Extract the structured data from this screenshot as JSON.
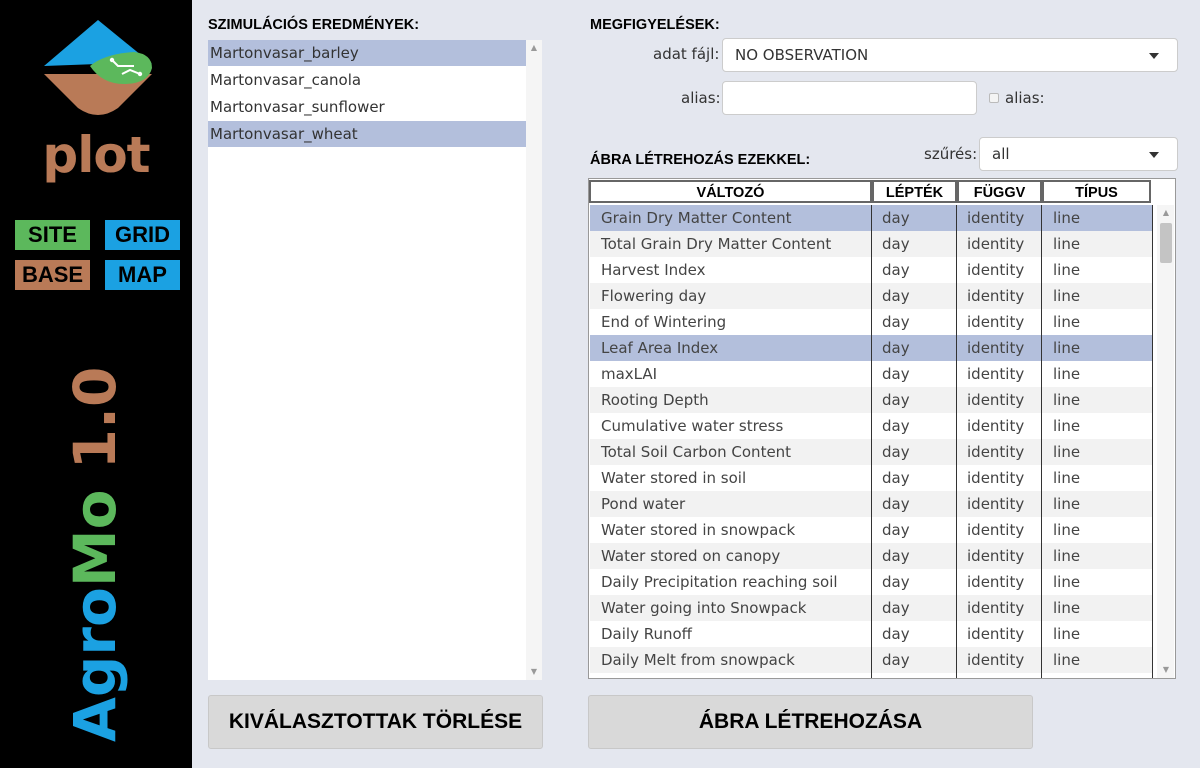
{
  "sidebar": {
    "logo_text": "plot",
    "nav": {
      "site": "SITE",
      "grid": "GRID",
      "base": "BASE",
      "map": "MAP"
    },
    "brand": {
      "part1": "Agro",
      "part2": "Mo",
      "part3": " 1.0"
    }
  },
  "results": {
    "title": "SZIMULÁCIÓS EREDMÉNYEK:",
    "items": [
      {
        "label": "Martonvasar_barley",
        "selected": true
      },
      {
        "label": "Martonvasar_canola",
        "selected": false
      },
      {
        "label": "Martonvasar_sunflower",
        "selected": false
      },
      {
        "label": "Martonvasar_wheat",
        "selected": true
      }
    ]
  },
  "observations": {
    "title": "MEGFIGYELÉSEK:",
    "file_label": "adat fájl:",
    "file_value": "NO OBSERVATION",
    "alias_label": "alias:",
    "alias_value": "",
    "alias_checkbox_label": "alias:",
    "alias_checked": false
  },
  "plot_creation": {
    "title": "ÁBRA LÉTREHOZÁS EZEKKEL:",
    "filter_label": "szűrés:",
    "filter_value": "all",
    "columns": [
      "VÁLTOZÓ",
      "LÉPTÉK",
      "FÜGGV",
      "TÍPUS"
    ],
    "rows": [
      {
        "var": "Grain Dry Matter Content",
        "step": "day",
        "func": "identity",
        "type": "line",
        "selected": true
      },
      {
        "var": "Total Grain Dry Matter Content",
        "step": "day",
        "func": "identity",
        "type": "line",
        "selected": false
      },
      {
        "var": "Harvest Index",
        "step": "day",
        "func": "identity",
        "type": "line",
        "selected": false
      },
      {
        "var": "Flowering day",
        "step": "day",
        "func": "identity",
        "type": "line",
        "selected": false
      },
      {
        "var": "End of Wintering",
        "step": "day",
        "func": "identity",
        "type": "line",
        "selected": false
      },
      {
        "var": "Leaf Area Index",
        "step": "day",
        "func": "identity",
        "type": "line",
        "selected": true
      },
      {
        "var": "maxLAI",
        "step": "day",
        "func": "identity",
        "type": "line",
        "selected": false
      },
      {
        "var": "Rooting Depth",
        "step": "day",
        "func": "identity",
        "type": "line",
        "selected": false
      },
      {
        "var": "Cumulative water stress",
        "step": "day",
        "func": "identity",
        "type": "line",
        "selected": false
      },
      {
        "var": "Total Soil Carbon Content",
        "step": "day",
        "func": "identity",
        "type": "line",
        "selected": false
      },
      {
        "var": "Water stored in soil",
        "step": "day",
        "func": "identity",
        "type": "line",
        "selected": false
      },
      {
        "var": "Pond water",
        "step": "day",
        "func": "identity",
        "type": "line",
        "selected": false
      },
      {
        "var": "Water stored in snowpack",
        "step": "day",
        "func": "identity",
        "type": "line",
        "selected": false
      },
      {
        "var": "Water stored on canopy",
        "step": "day",
        "func": "identity",
        "type": "line",
        "selected": false
      },
      {
        "var": "Daily Precipitation reaching soil",
        "step": "day",
        "func": "identity",
        "type": "line",
        "selected": false
      },
      {
        "var": "Water going into Snowpack",
        "step": "day",
        "func": "identity",
        "type": "line",
        "selected": false
      },
      {
        "var": "Daily Runoff",
        "step": "day",
        "func": "identity",
        "type": "line",
        "selected": false
      },
      {
        "var": "Daily Melt from snowpack",
        "step": "day",
        "func": "identity",
        "type": "line",
        "selected": false
      }
    ]
  },
  "buttons": {
    "clear": "KIVÁLASZTOTTAK TÖRLÉSE",
    "create": "ÁBRA LÉTREHOZÁSA"
  },
  "colors": {
    "green": "#5cb85c",
    "blue": "#1ba1e2",
    "brown": "#b97a57",
    "selection": "#b3bfdc"
  }
}
